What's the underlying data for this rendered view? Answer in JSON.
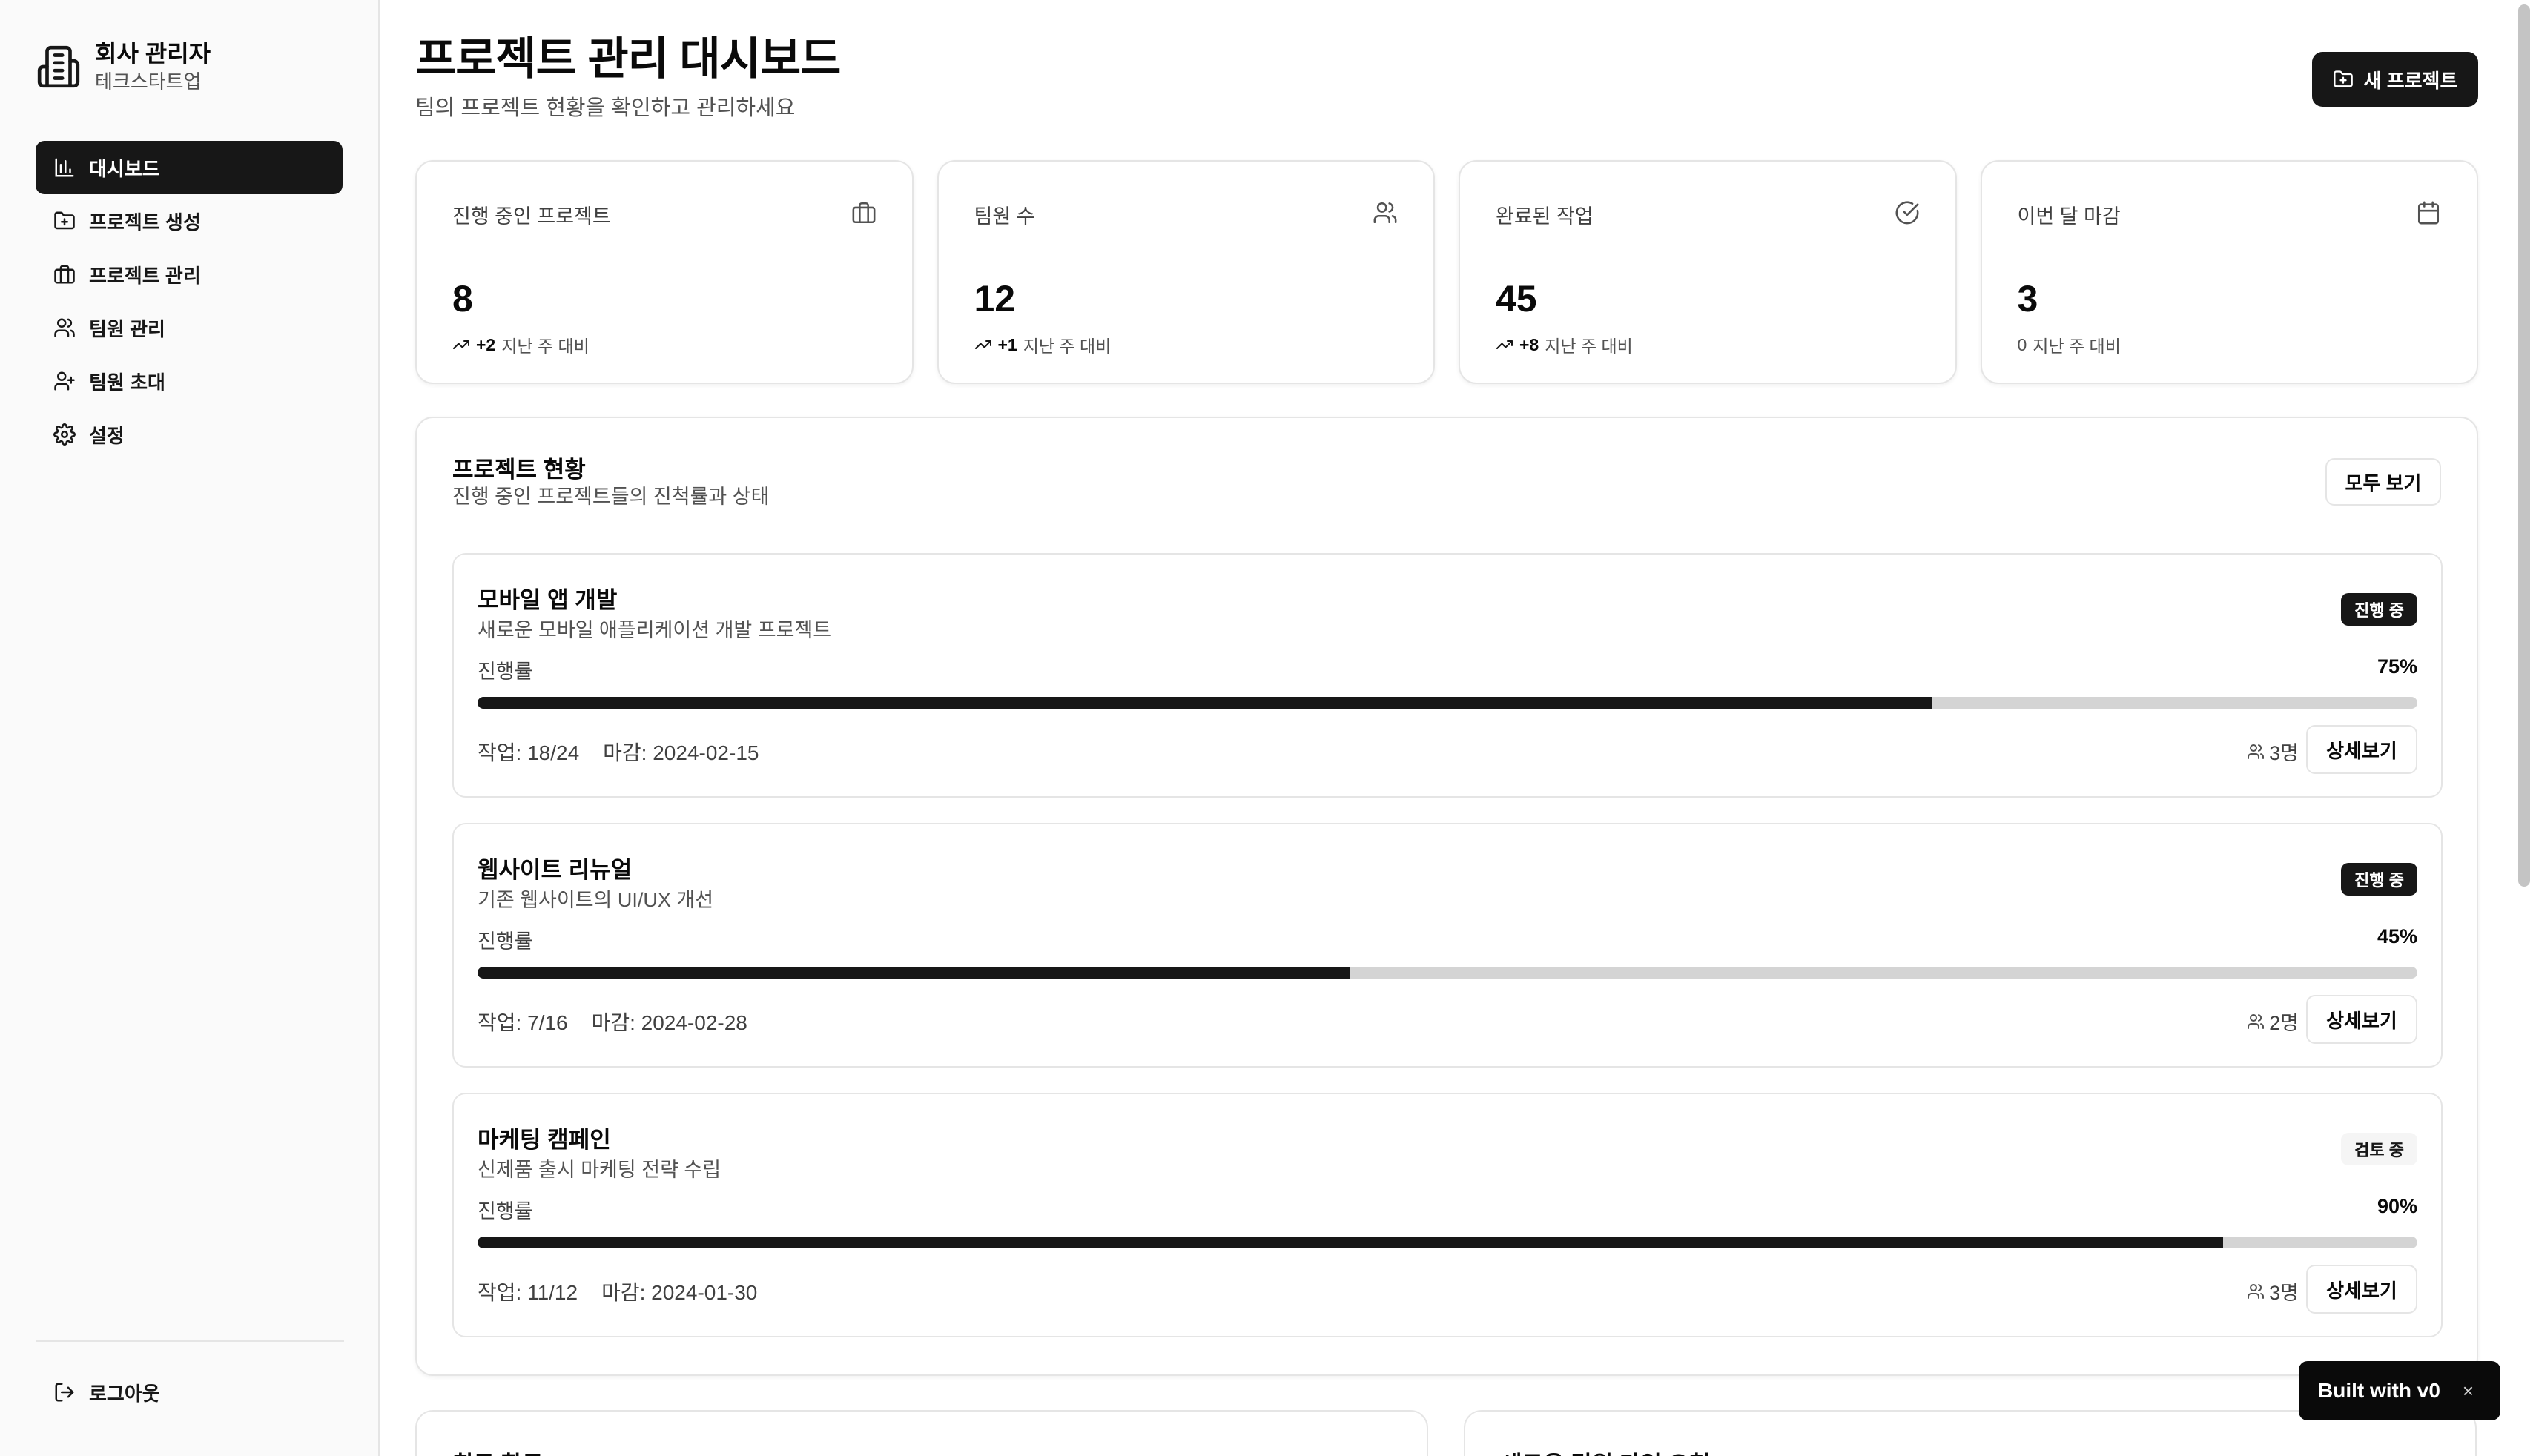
{
  "sidebar": {
    "title": "회사 관리자",
    "subtitle": "테크스타트업",
    "items": [
      {
        "label": "대시보드",
        "icon": "bar-chart-icon",
        "active": true
      },
      {
        "label": "프로젝트 생성",
        "icon": "folder-plus-icon"
      },
      {
        "label": "프로젝트 관리",
        "icon": "briefcase-icon"
      },
      {
        "label": "팀원 관리",
        "icon": "users-icon"
      },
      {
        "label": "팀원 초대",
        "icon": "user-plus-icon"
      },
      {
        "label": "설정",
        "icon": "gear-icon"
      }
    ],
    "logout": "로그아웃"
  },
  "header": {
    "title": "프로젝트 관리 대시보드",
    "subtitle": "팀의 프로젝트 현황을 확인하고 관리하세요",
    "new_button": "새 프로젝트"
  },
  "stats": [
    {
      "label": "진행 중인 프로젝트",
      "value": "8",
      "delta": "+2",
      "delta_text": "지난 주 대비",
      "icon": "briefcase-icon"
    },
    {
      "label": "팀원 수",
      "value": "12",
      "delta": "+1",
      "delta_text": "지난 주 대비",
      "icon": "users-icon"
    },
    {
      "label": "완료된 작업",
      "value": "45",
      "delta": "+8",
      "delta_text": "지난 주 대비",
      "icon": "check-circle-icon"
    },
    {
      "label": "이번 달 마감",
      "value": "3",
      "delta": "0",
      "delta_text": "지난 주 대비",
      "icon": "calendar-icon"
    }
  ],
  "projects_panel": {
    "title": "프로젝트 현황",
    "subtitle": "진행 중인 프로젝트들의 진척률과 상태",
    "view_all": "모두 보기",
    "progress_label": "진행률",
    "detail_label": "상세보기",
    "projects": [
      {
        "name": "모바일 앱 개발",
        "desc": "새로운 모바일 애플리케이션 개발 프로젝트",
        "status": "진행 중",
        "status_style": "dark",
        "percent": "75%",
        "progress": 0.75,
        "tasks": "작업: 18/24",
        "deadline": "마감: 2024-02-15",
        "members": "3명"
      },
      {
        "name": "웹사이트 리뉴얼",
        "desc": "기존 웹사이트의 UI/UX 개선",
        "status": "진행 중",
        "status_style": "dark",
        "percent": "45%",
        "progress": 0.45,
        "tasks": "작업: 7/16",
        "deadline": "마감: 2024-02-28",
        "members": "2명"
      },
      {
        "name": "마케팅 캠페인",
        "desc": "신제품 출시 마케팅 전략 수립",
        "status": "검토 중",
        "status_style": "light",
        "percent": "90%",
        "progress": 0.9,
        "tasks": "작업: 11/12",
        "deadline": "마감: 2024-01-30",
        "members": "3명"
      }
    ]
  },
  "bottom": {
    "left_title": "최근 활동",
    "right_title": "새로운 팀원 가입 요청"
  },
  "badge": {
    "text": "Built with v0",
    "close": "×"
  }
}
